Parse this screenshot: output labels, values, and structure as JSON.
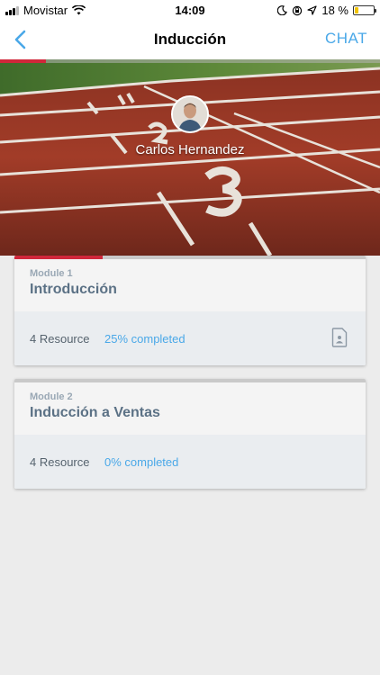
{
  "status_bar": {
    "carrier": "Movistar",
    "time": "14:09",
    "battery_percent": "18 %",
    "battery_level": 0.18,
    "signal_bars_active": 3,
    "signal_bars_total": 4
  },
  "nav": {
    "title": "Inducción",
    "chat_label": "CHAT",
    "accent_color": "#4aa8e8"
  },
  "hero": {
    "user_name": "Carlos Hernandez",
    "course_progress": 0.12
  },
  "modules": [
    {
      "number_label": "Module 1",
      "title": "Introducción",
      "resources": "4 Resource",
      "completed_label": "25% completed",
      "progress": 0.25,
      "has_doc_icon": true
    },
    {
      "number_label": "Module 2",
      "title": "Inducción a Ventas",
      "resources": "4 Resource",
      "completed_label": "0% completed",
      "progress": 0.0,
      "has_doc_icon": false
    }
  ],
  "colors": {
    "progress_red": "#d0273a",
    "link_blue": "#4aa8e8",
    "title_slate": "#5b7185"
  }
}
